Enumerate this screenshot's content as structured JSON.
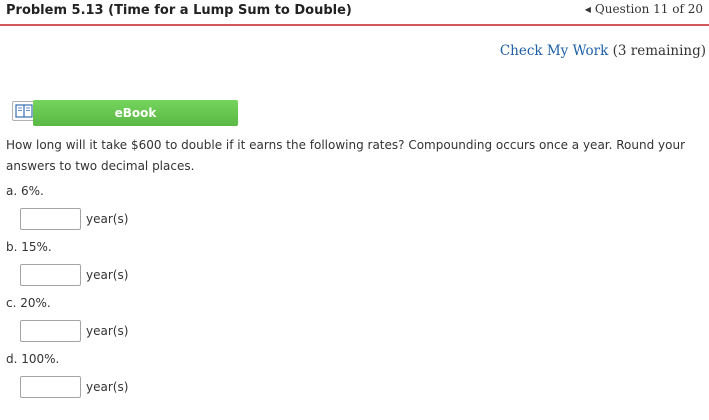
{
  "header": {
    "title": "Problem 5.13 (Time for a Lump Sum to Double)",
    "question_nav": "Question 11 of 20"
  },
  "check_work": {
    "link": "Check My Work",
    "remaining": "(3 remaining)"
  },
  "ebook": {
    "label": "eBook"
  },
  "question_text": "How long will it take $600 to double if it earns the following rates? Compounding occurs once a year. Round your answers to two decimal places.",
  "parts": [
    {
      "label": "a. 6%.",
      "value": "",
      "unit": "year(s)"
    },
    {
      "label": "b. 15%.",
      "value": "",
      "unit": "year(s)"
    },
    {
      "label": "c. 20%.",
      "value": "",
      "unit": "year(s)"
    },
    {
      "label": "d. 100%.",
      "value": "",
      "unit": "year(s)"
    }
  ]
}
